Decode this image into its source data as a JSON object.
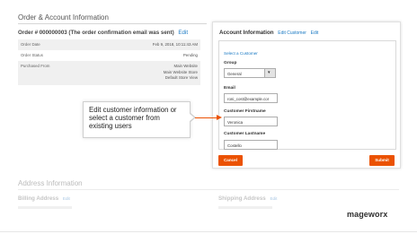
{
  "page": {
    "section_title": "Order & Account Information"
  },
  "order": {
    "heading": "Order # 000000003 (The order confirmation email was sent)",
    "edit_label": "Edit",
    "rows": [
      {
        "label": "Order Date",
        "value_lines": [
          "Feb 9, 2018, 10:11:43 AM"
        ]
      },
      {
        "label": "Order Status",
        "value_lines": [
          "Pending"
        ]
      },
      {
        "label": "Purchased From",
        "value_lines": [
          "Main Website",
          "Main Website Store",
          "Default Store View"
        ]
      }
    ]
  },
  "account_panel": {
    "title": "Account Information",
    "edit_customer_label": "Edit Customer",
    "edit_label": "Edit",
    "select_customer_label": "Select a Customer",
    "group_label": "Group",
    "group_value": "General",
    "email_label": "Email",
    "email_value": "roni_cost@example.cor",
    "firstname_label": "Customer Firstname",
    "firstname_value": "Veronica",
    "lastname_label": "Customer Lastname",
    "lastname_value": "Costello",
    "cancel_label": "Cancel",
    "submit_label": "Submit"
  },
  "callout": {
    "text": "Edit customer information or select a customer from existing users"
  },
  "address": {
    "title": "Address Information",
    "billing_label": "Billing Address",
    "billing_edit": "Edit",
    "shipping_label": "Shipping Address",
    "shipping_edit": "Edit"
  },
  "brand": {
    "name": "mageworx"
  },
  "colors": {
    "accent": "#eb5202",
    "link": "#1979c3"
  },
  "icons": {
    "group_select": "chevron-down-icon"
  }
}
